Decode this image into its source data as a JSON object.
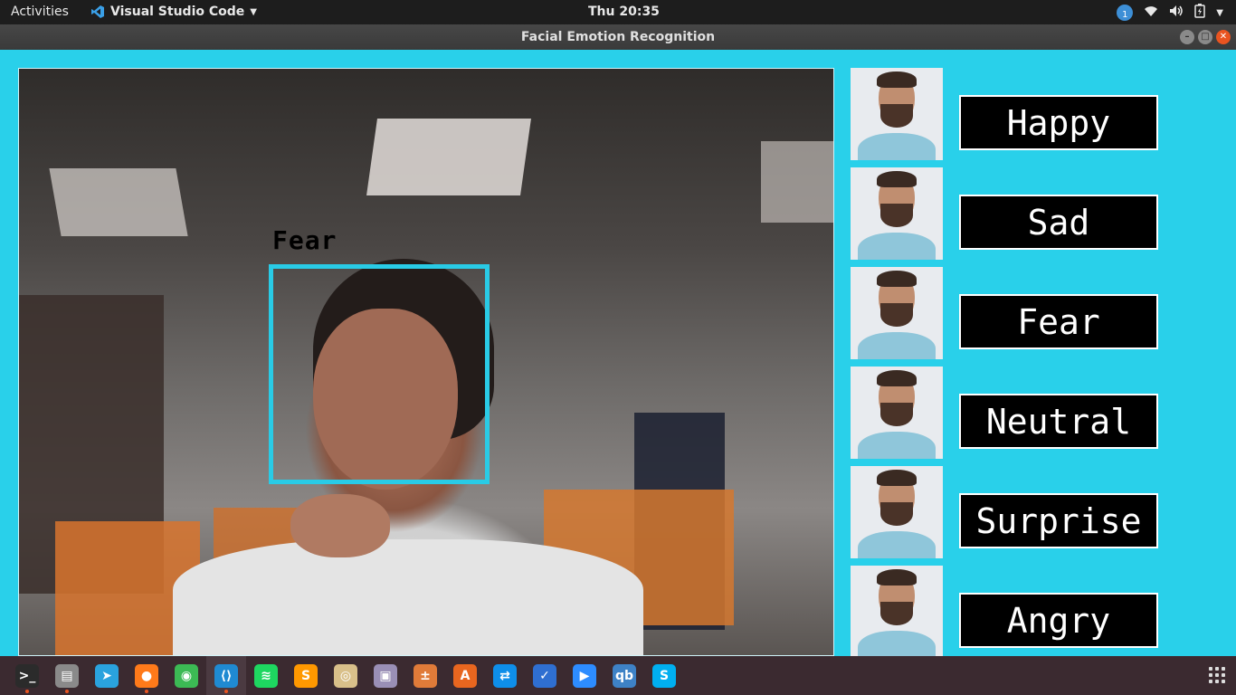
{
  "topbar": {
    "activities": "Activities",
    "app_name": "Visual Studio Code",
    "clock": "Thu 20:35",
    "notification_count": "1"
  },
  "window": {
    "title": "Facial Emotion Recognition"
  },
  "feed": {
    "detected_emotion": "Fear"
  },
  "emotions": [
    {
      "label": "Happy"
    },
    {
      "label": "Sad"
    },
    {
      "label": "Fear"
    },
    {
      "label": "Neutral"
    },
    {
      "label": "Surprise"
    },
    {
      "label": "Angry"
    }
  ],
  "dock": [
    {
      "name": "terminal-icon",
      "glyph": ">_",
      "color": "#2b2b2b"
    },
    {
      "name": "files-icon",
      "glyph": "▤",
      "color": "#8a8a8a"
    },
    {
      "name": "telegram-icon",
      "glyph": "➤",
      "color": "#2aa3de"
    },
    {
      "name": "firefox-icon",
      "glyph": "●",
      "color": "#ff7a1a"
    },
    {
      "name": "chrome-icon",
      "glyph": "◉",
      "color": "#3cba54"
    },
    {
      "name": "vscode-icon",
      "glyph": "⟨⟩",
      "color": "#1f8ad2"
    },
    {
      "name": "spotify-icon",
      "glyph": "≋",
      "color": "#1ed760"
    },
    {
      "name": "sublime-icon",
      "glyph": "S",
      "color": "#ff9800"
    },
    {
      "name": "music-player-icon",
      "glyph": "◎",
      "color": "#d9c08a"
    },
    {
      "name": "screenshot-icon",
      "glyph": "▣",
      "color": "#9a8fb6"
    },
    {
      "name": "calculator-icon",
      "glyph": "±",
      "color": "#e07b39"
    },
    {
      "name": "software-center-icon",
      "glyph": "A",
      "color": "#e8661f"
    },
    {
      "name": "teamviewer-icon",
      "glyph": "⇄",
      "color": "#0e8ee9"
    },
    {
      "name": "tasks-icon",
      "glyph": "✓",
      "color": "#2f6fd1"
    },
    {
      "name": "zoom-icon",
      "glyph": "▶",
      "color": "#2d8cff"
    },
    {
      "name": "qbittorrent-icon",
      "glyph": "qb",
      "color": "#3e82c6"
    },
    {
      "name": "skype-icon",
      "glyph": "S",
      "color": "#00aff0"
    }
  ]
}
